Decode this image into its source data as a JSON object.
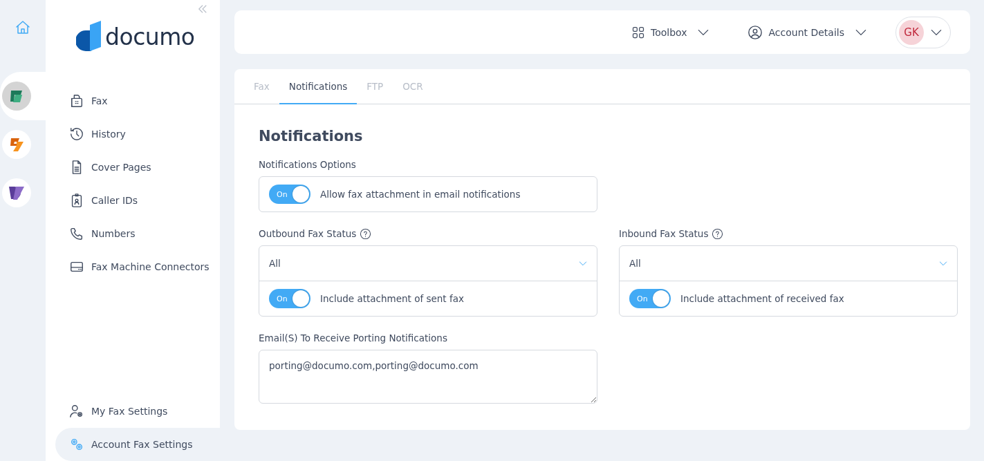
{
  "rail": {
    "apps": [
      {
        "kind": "home",
        "selected": false
      },
      {
        "kind": "fax",
        "selected": true
      },
      {
        "kind": "sign",
        "selected": false
      },
      {
        "kind": "docs",
        "selected": false
      }
    ]
  },
  "sidebar": {
    "logo": "documo",
    "items": [
      {
        "label": "Fax",
        "selected": false
      },
      {
        "label": "History",
        "selected": false
      },
      {
        "label": "Cover Pages",
        "selected": false
      },
      {
        "label": "Caller IDs",
        "selected": false
      },
      {
        "label": "Numbers",
        "selected": false
      },
      {
        "label": "Fax Machine Connectors",
        "selected": false
      }
    ],
    "bottom_items": [
      {
        "label": "My Fax Settings",
        "selected": false
      },
      {
        "label": "Account Fax Settings",
        "selected": true
      }
    ]
  },
  "topbar": {
    "toolbox": "Toolbox",
    "account": "Account Details",
    "avatar": "GK"
  },
  "tabs": [
    {
      "label": "Fax",
      "selected": false
    },
    {
      "label": "Notifications",
      "selected": true
    },
    {
      "label": "FTP",
      "selected": false
    },
    {
      "label": "OCR",
      "selected": false
    }
  ],
  "panel": {
    "heading": "Notifications",
    "options_label": "Notifications Options",
    "option": {
      "toggle_text": "On",
      "on": true,
      "label": "Allow fax attachment in email notifications"
    },
    "status_groups": [
      {
        "label": "Outbound Fax Status",
        "value": "All",
        "toggle_text": "On",
        "on": true,
        "toggle_label": "Include attachment of sent fax"
      },
      {
        "label": "Inbound Fax Status",
        "value": "All",
        "toggle_text": "On",
        "on": true,
        "toggle_label": "Include attachment of received fax"
      }
    ],
    "email": {
      "label": "Email(S) To Receive Porting Notifications",
      "value": "porting@documo.com,porting@documo.com"
    }
  }
}
